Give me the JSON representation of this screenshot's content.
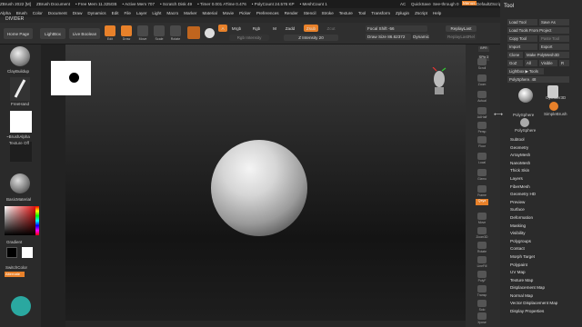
{
  "titlebar": {
    "items": [
      "ZBrush 2022 [M]",
      "ZBrush Document",
      "• Free Mem 11.325GB",
      "• Active Mem 707",
      "• Scratch Disk 49",
      "• Timer 0.001 ATime 0.476",
      "• PolyCount 24.576 KP",
      "• MeshCount 1"
    ],
    "ac": "AC",
    "quicksave": "QuickSave",
    "seethrough": "See-through 0",
    "menus": "Menus",
    "script": "DefaultZScript"
  },
  "menubar": [
    "Alpha",
    "Brush",
    "Color",
    "Document",
    "Draw",
    "Dynamics",
    "Edit",
    "File",
    "Layer",
    "Light",
    "Macro",
    "Marker",
    "Material",
    "Movie",
    "Picker",
    "Preferences",
    "Render",
    "Stencil",
    "Stroke",
    "Texture",
    "Tool",
    "Transform",
    "Zplugin",
    "Zscript",
    "Help"
  ],
  "subtitle": "DIVIDER",
  "toolbar": {
    "home": "Home Page",
    "lightbox": "LightBox",
    "livebool": "Live Boolean",
    "edit": "Edit",
    "draw": "Draw",
    "move": "Move",
    "scale": "Scale",
    "rotate": "Rotate",
    "mrgb": "Mrgb",
    "rgb": "Rgb",
    "m": "M",
    "zadd": "Zadd",
    "zsub": "Zsub",
    "zcut": "Zcut",
    "a": "A",
    "rgb_intensity": "Rgb Intensity",
    "z_intensity": "Z Intensity 20",
    "focal": "Focal Shift -56",
    "drawsize": "Draw Size 86.62372",
    "dynamic": "Dynamic",
    "replaylast": "ReplayLast",
    "replaylastrel": "ReplayLastRel"
  },
  "leftshelf": {
    "brush": "ClayBuildup",
    "stroke": "FreeHand",
    "alpha": "~BrushAlpha",
    "texture": "Texture Off",
    "material": "BasicMaterial",
    "gradient": "Gradient",
    "switchcolor": "SwitchColor",
    "alternate": "Alternate"
  },
  "rightshelf": [
    "BPR",
    "SPix 3",
    "Scroll",
    "Zoom",
    "Actual",
    "AAHalf",
    "Persp",
    "Floor",
    "Local",
    "Gizmo",
    "Frame",
    "Move",
    "Zoom3D",
    "Rotate",
    "LineFill",
    "PolyF",
    "Transp",
    "Solo",
    "Xpose",
    "Dynamic"
  ],
  "panel": {
    "title": "Tool",
    "buttons": [
      [
        "Load Tool",
        "Save As"
      ],
      [
        "Load Tools From Project",
        ""
      ],
      [
        "Copy Tool",
        "Paste Tool"
      ],
      [
        "Import",
        "Export"
      ],
      [
        "Clone",
        "Make PolyMesh3D"
      ],
      [
        "GoZ",
        "All",
        "Visible",
        "R"
      ],
      [
        "Lightbox ▶ Tools",
        ""
      ]
    ],
    "current": "PolySphere. 48",
    "tools": [
      "PolySphere",
      "Cylinder3D",
      "SimpleBrush",
      "PolySphere"
    ],
    "subpalettes": [
      "Subtool",
      "Geometry",
      "ArrayMesh",
      "NanoMesh",
      "Thick Skin",
      "Layers",
      "FiberMesh",
      "Geometry HD",
      "Preview",
      "Surface",
      "Deformation",
      "Masking",
      "Visibility",
      "Polygroups",
      "Contact",
      "Morph Target",
      "Polypaint",
      "UV Map",
      "Texture Map",
      "Displacement Map",
      "Normal Map",
      "Vector Displacement Map",
      "Display Properties"
    ]
  },
  "colors": {
    "accent": "#e8812a",
    "primary": "#000000",
    "secondary": "#ffffff"
  }
}
